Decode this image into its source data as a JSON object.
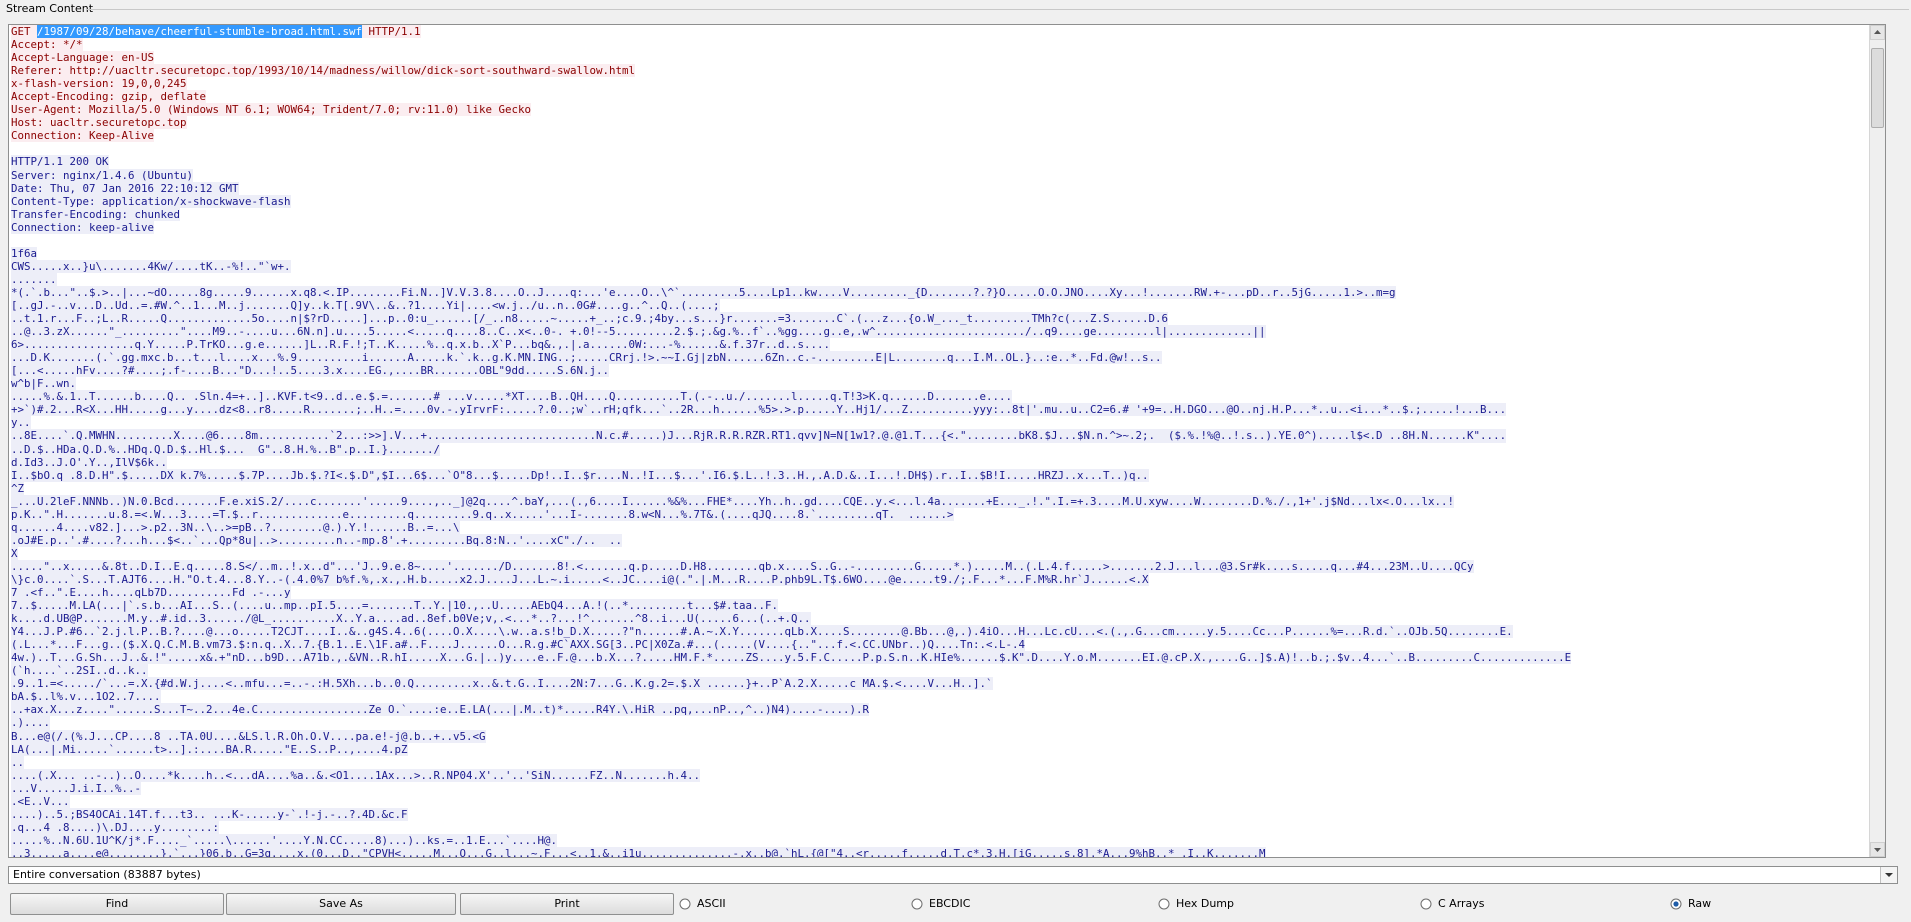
{
  "window": {
    "frame_title": "Stream Content"
  },
  "request_lines": [
    {
      "pre": "GET ",
      "sel": "/1987/09/28/behave/cheerful-stumble-broad.html.swf",
      "post": " HTTP/1.1"
    },
    {
      "pre": "Accept: */*"
    },
    {
      "pre": "Accept-Language: en-US"
    },
    {
      "pre": "Referer: http://uacltr.securetopc.top/1993/10/14/madness/willow/dick-sort-southward-swallow.html"
    },
    {
      "pre": "x-flash-version: 19,0,0,245"
    },
    {
      "pre": "Accept-Encoding: gzip, deflate"
    },
    {
      "pre": "User-Agent: Mozilla/5.0 (Windows NT 6.1; WOW64; Trident/7.0; rv:11.0) like Gecko"
    },
    {
      "pre": "Host: uacltr.securetopc.top"
    },
    {
      "pre": "Connection: Keep-Alive"
    },
    {
      "pre": ""
    }
  ],
  "response_lines": [
    "HTTP/1.1 200 OK",
    "Server: nginx/1.4.6 (Ubuntu)",
    "Date: Thu, 07 Jan 2016 22:10:12 GMT",
    "Content-Type: application/x-shockwave-flash",
    "Transfer-Encoding: chunked",
    "Connection: keep-alive",
    "",
    "1f6a",
    "CWS.....x..}u\\.......4Kw/....tK..-%!..\"`w+.",
    ".......",
    "*(.`.b...\"..$.>..|...~dO.....8g.....9......x.q8.<.IP........Fi.N..]V.V.3.8....O..J....q:...'e....O..\\^`.........5....Lp1..kw....V........._{D.......?.?}O.....O.O.JNO....Xy...!.......RW.+-...pD..r..5jG.....1.>..m=g",
    "[..gJ.-..v...D..Ud..=.#W.^..1...M..j.......Q]y..k.T[.9V\\..&..?1....Yi|....<w.j../u..n..0G#....g..^..Q..(....;",
    "..t.1.r...F..;L..R.....Q.............5o....n|$?rD.....]...p..0:u_......[/_..n8.....~.....+_..;c.9.;4by...s...}r.......=3.......C`.(...z...{o.W_..._t.........TMh?c(...Z.S......D.6",
    "..@..3.zX......\"_.........\"....M9..-....u...6N.n].u....5.....<.....q....8..C..x<..0-. +.0!--5.........2.$.;.&g.%..f`..%gg....g..e,.w^......................./..q9....ge.........l|.............||",
    "6>.................q.Y.....P.TrKO...g.e......]L..R.F.!;T..K.....%..q.x.b..X`P...bq&.,.|.a......0W:...-%......&.f.37r..d..s....",
    "...D.K.......(.`.gg.mxc.b...t...l....x...%.9..........i......A.....k.`.k..g.K.MN.ING..;.....CRrj.!>.~~I.Gj|zbN......6Zn..c.-.........E|L........q...I.M..OL.}..:e..*..Fd.@w!..s..",
    "[...<.....hFv....?#....;.f-....B...\"D...!..5....3.x....EG.,....BR.......OBL\"9dd.....S.6N.j..",
    "w^b|F..wn.",
    ".....%.&.1..T......b....Q.. .Sln.4=+..]..KVF.t<9..d..e.$.=.......# ...v.....*XT....B..QH....Q..........T.(.-..u./.......l.....q.T!3>K.q......D.......e....",
    "+>`)#.2...R<X...HH.....g...y....dz<8..r8.....R.......;..H..=....0v.-.yIrvrF:.....?.0..;w`..rH;qfk...`..2R...h......%5>.>.p.....Y..Hj1/...Z..........yyy:..8t|'.mu..u..C2=6.# '+9=..H.DGO...@O..nj.H.P...*..u..<i...*..$.;.....!...B...",
    "y..",
    "..8E....`.Q.MWHN.........X....@6....8m...........`2...:>>].V...+..........................N.c.#.....)J...RjR.R.R.RZR.RT1.qvv]N=N[1w1?.@.@1.T...{<.\"........bK8.$J...$N.n.^>~.2;.  ($.%.!%@..!.s..).YE.0^).....l$<.D ..8H.N......K\"....",
    "..D.$..HDa.Q.D.%..HDq.Q.D.$..Hl.$...  G\"..8.H.%..B\".p..I.}......./",
    "d.Id3..J.O'.Y..,IlV$6k..",
    "I..$bO.q .8.D.H\".$.....DX k.7%.....$.7P....Jb.$.?I<.$.D\",$I...6$...`O\"8...$.....Dp!..I..$r....N..!I...$...'.I6.$.L..!.3..H.,.A.D.&..I...!.DH$).r..I..$B!I.....HRZJ..x...T..)q..",
    "^Z",
    "_...U.2leF.NNNb..)N.0.Bcd.......F.e.xiS.2/....c.......'.....9....,.._]@2q....^.baY,...(.,6....I......%&%...FHE*....Yh..h..gd....CQE..y.<...l.4a.......+E..._.!.\".I.=+.3....M.U.xyw....W........D.%./.,1+'.j$Nd...lx<.O...lx..!",
    "p.K..\".H.......u.8.=<.W...3....=T.$..r.............e.........q.........9.q..x.....'...I-.......8.w<N...%.7T&.(....qJQ....8.`.........qT.  ......>",
    "q......4....v82.]...>.p2..3N..\\..>=pB..?........@.).Y.!......B..=...\\",
    ".oJ#E.p..'.#....?...h...$<..`...Qp*8u|..>.........n..-mp.8'.+.........Bq.8:N..'....xC\"./..  ..",
    "X",
    ".....\"..x.....&.8t..D.I..E.q.....8.S</..m..!.x..d\"...'J..9.e.8~....'......./D.......8!.<.......q.p.....D.H8........qb.x....S..G..-.........G.....*.).....M..(.L.4.f.....>.......2.J...l...@3.Sr#k....s.....q...#4...23M..U....QCy",
    "\\}c.0....`.S...T.AJT6....H.\"O.t.4...8.Y..-(.4.0%7 b%f.%,.x.,.H.b.....x2.J....J...L.~.i.....<..JC....i@(.\".|.M...R....P.phb9L.T$.6WO....@e.....t9./;.F...*...F.M%R.hr`J......<.X",
    "7 .<f..\".E....h....qLb7D..........Fd .-...y",
    "7..$.....M.LA(...|`.s.b...AI...S..(....u..mp..pI.5....=.......T..Y.|10.,..U.....AEbQ4...A.!(..*.........t...$#.taa..F.",
    "k....d.UB@P.......M.y..#.id..3....../@L_..........X..Y.a....ad..8ef.b0Ve;v,.<...*..?...!^.......^8..i...U(.....6...(..+.Q..",
    "Y4...J.P.#6..`2.j.l.P..B.?....@...o.....T2CJT....I..&..g4S.4..6(....O.X....\\.w..a.s!b_D.X.....?\"n......#.A.~.X.Y.......qLb.X....S........@.Bb...@,.).4iO...H...Lc.cU...<.(.,.G...cm.....y.5....Cc...P......%=...R.d.`..OJb.5Q........E.",
    "(.L...*...F...g..($.X.Q.C.M.B.vm73.$:n.q..X..7.{B.1..E.\\1F.a#..F....J......O...R.g.#C`AXX.SG[3..PC|X0Za.#...(.....(V....{..\"...f.<.CC.UNbr..)Q....Tn:.<.L-.4",
    "4w.)..T...G.Sh...J..&.!\".....x&.+\"nD...b9D...A71b.,.&VN..R.hI.....X...G.|..)y....e..F.@...b.X...?.....HM.F.*.....ZS....y.5.F.C.....P.p.S.n..K.HIe%......$.K\".D....Y.o.M.......EI.@.cP.X.,....G..]$.A)!..b.;.$v..4...`..B.........C.............E",
    "(`h....`..2SI..d..k..",
    ".9..1.=<...../`...=.X.{#d.W.j....<..mfu...=..-.:H.5Xh...b..0.Q.........x..&.t.G..I....2N:7...G..K.g.2=.$.X ......}+..P`A.2.X.....c MA.$.<....V...H..].`",
    "bA.$..l%.v...1O2..7....",
    "..+ax.X...z....\"......S...T~..2...4e.C.................Ze O.`....:e..E.LA(...|.M..t)*.....R4Y.\\.HiR ..pq,...nP..,^..)N4)....-....).R",
    ".)....",
    "B...e@(/.(%.J...CP....8 ..TA.0U....&LS.l.R.Oh.O.V....pa.e!-j@.b..+..v5.<G",
    "LA(...|.Mi.....`......t>..].:....BA.R.....\"E..S..P..,....4.pZ",
    "..",
    "....(.X... ..-..)..O....*k....h..<...dA....%a..&.<O1....1Ax...>..R.NP04.X'..'..'SiN......FZ..N.......h.4..",
    "...V.....J.i.I..%..-",
    ".<E..V...",
    "....)..5.;BS4OCAi.14T.f...t3.. ...K-.....y-`.!-j.-..?.4D.&c.F",
    ".q...4 .8....)\\.DJ....y........:",
    ".....%..N.6U.1U^K/j*.F...._`.....\\......'....Y.N.CC.....8)...)..ks.=..1.E...`....H@.",
    "..3.....a....e@........}.`...}06.b..G=3q....x.(0...D..\"CPVH<.....M...O...G..l...~.F...<..1.&..i1u..............-.x..b@.`hL.{@[\"4..<r.....f.....d.T.c*.3.H.[iG.....s.8].*A...9%hB..* .I..K.......M"
  ],
  "scrollbar": {
    "up_icon": "arrow-up-icon",
    "down_icon": "arrow-down-icon"
  },
  "conversation_select": {
    "value": "Entire conversation (83887 bytes)"
  },
  "buttons": {
    "find": "Find",
    "save_as": "Save As",
    "print": "Print"
  },
  "show_as": {
    "options": [
      "ASCII",
      "EBCDIC",
      "Hex Dump",
      "C Arrays",
      "Raw"
    ],
    "selected": "Raw"
  }
}
